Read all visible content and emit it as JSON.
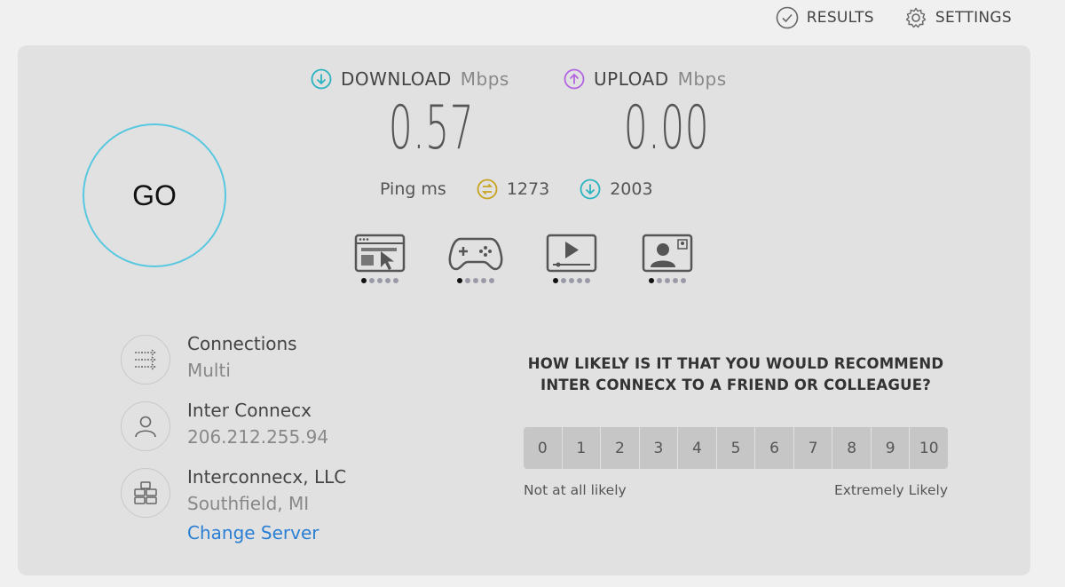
{
  "nav": {
    "results_label": "RESULTS",
    "settings_label": "SETTINGS"
  },
  "go_label": "GO",
  "download": {
    "label": "DOWNLOAD",
    "unit": "Mbps",
    "value": "0.57",
    "color": "#2ab3c0"
  },
  "upload": {
    "label": "UPLOAD",
    "unit": "Mbps",
    "value": "0.00",
    "color": "#b364e0"
  },
  "ping": {
    "label": "Ping",
    "unit": "ms",
    "idle": "1273",
    "download": "2003",
    "idle_color": "#c8a420",
    "download_color": "#2ab3c0"
  },
  "activities": [
    {
      "icon": "web-browsing-icon",
      "level": 1,
      "max": 5
    },
    {
      "icon": "gaming-icon",
      "level": 1,
      "max": 5
    },
    {
      "icon": "video-streaming-icon",
      "level": 1,
      "max": 5
    },
    {
      "icon": "video-chat-icon",
      "level": 1,
      "max": 5
    }
  ],
  "connections": {
    "title": "Connections",
    "value": "Multi"
  },
  "provider": {
    "name": "Inter Connecx",
    "ip": "206.212.255.94"
  },
  "server": {
    "name": "Interconnecx, LLC",
    "location": "Southfield, MI",
    "change_label": "Change Server"
  },
  "survey": {
    "question": "HOW LIKELY IS IT THAT YOU WOULD RECOMMEND INTER CONNECX TO A FRIEND OR COLLEAGUE?",
    "options": [
      "0",
      "1",
      "2",
      "3",
      "4",
      "5",
      "6",
      "7",
      "8",
      "9",
      "10"
    ],
    "low_label": "Not at all likely",
    "high_label": "Extremely Likely"
  }
}
